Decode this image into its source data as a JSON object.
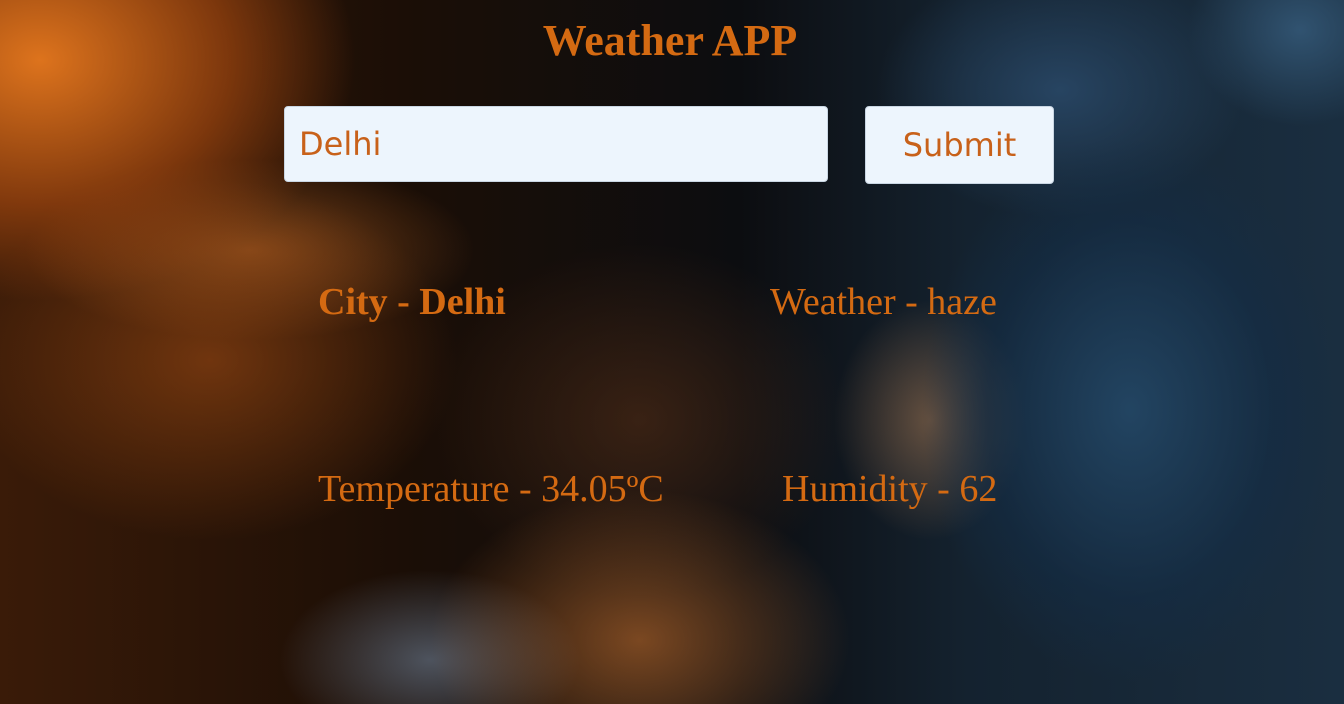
{
  "header": {
    "title": "Weather APP"
  },
  "search": {
    "value": "Delhi",
    "submit_label": "Submit"
  },
  "result": {
    "city": "City - Delhi",
    "weather": "Weather - haze",
    "temperature": "Temperature - 34.05ºC",
    "humidity": "Humidity - 62"
  },
  "colors": {
    "accent": "#d46a12",
    "input_background": "#edf5fd"
  }
}
